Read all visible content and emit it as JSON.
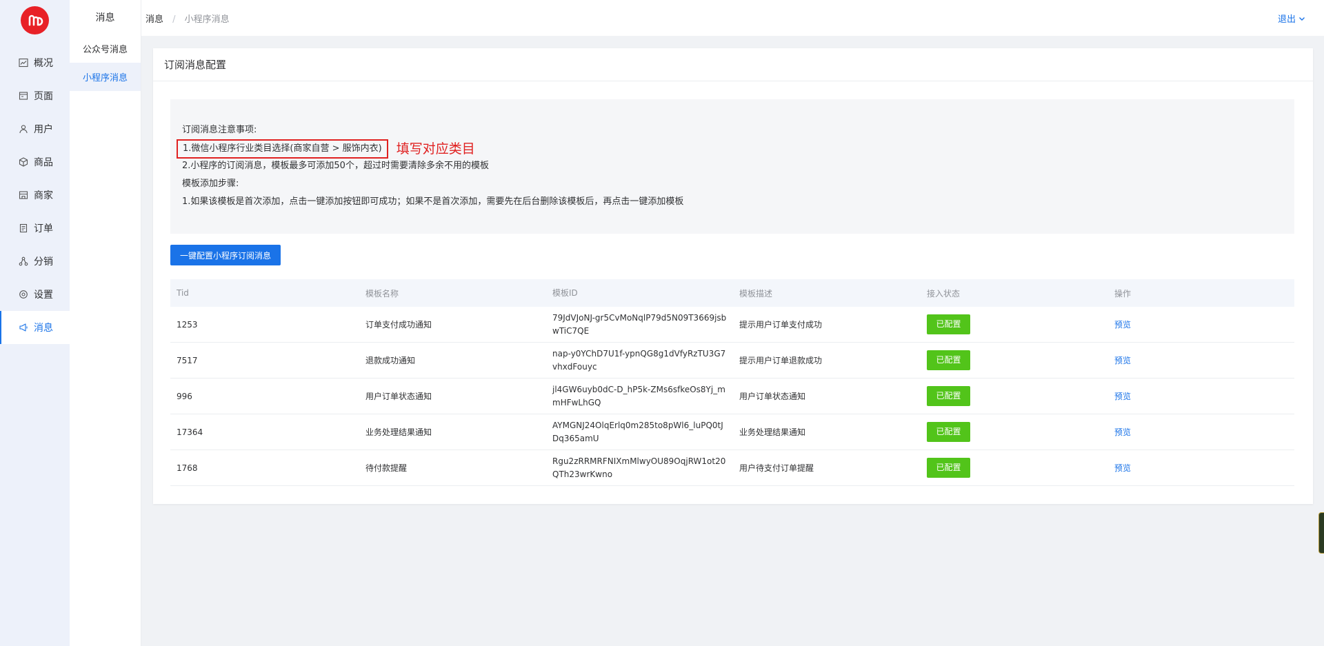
{
  "nav": {
    "items": [
      {
        "label": "概况",
        "icon": "chart-icon",
        "active": false
      },
      {
        "label": "页面",
        "icon": "page-icon",
        "active": false
      },
      {
        "label": "用户",
        "icon": "user-icon",
        "active": false
      },
      {
        "label": "商品",
        "icon": "box-icon",
        "active": false
      },
      {
        "label": "商家",
        "icon": "store-icon",
        "active": false
      },
      {
        "label": "订单",
        "icon": "order-icon",
        "active": false
      },
      {
        "label": "分销",
        "icon": "network-icon",
        "active": false
      },
      {
        "label": "设置",
        "icon": "gear-icon",
        "active": false
      },
      {
        "label": "消息",
        "icon": "megaphone-icon",
        "active": true
      }
    ]
  },
  "subnav": {
    "title": "消息",
    "items": [
      {
        "label": "公众号消息",
        "active": false
      },
      {
        "label": "小程序消息",
        "active": true
      }
    ]
  },
  "breadcrumb": {
    "root": "消息",
    "sep": "/",
    "current": "小程序消息"
  },
  "header": {
    "logout": "退出"
  },
  "card": {
    "title": "订阅消息配置",
    "notice": {
      "line0": "订阅消息注意事项:",
      "line1": "1.微信小程序行业类目选择(商家自营 > 服饰内衣)",
      "annotation": "填写对应类目",
      "line2": "2.小程序的订阅消息，模板最多可添加50个，超过时需要清除多余不用的模板",
      "line3": "模板添加步骤:",
      "line4": "1.如果该模板是首次添加，点击一键添加按钮即可成功；如果不是首次添加，需要先在后台删除该模板后，再点击一键添加模板"
    },
    "action_button": "一键配置小程序订阅消息"
  },
  "table": {
    "columns": [
      "Tid",
      "模板名称",
      "模板ID",
      "模板描述",
      "接入状态",
      "操作"
    ],
    "rows": [
      {
        "tid": "1253",
        "name": "订单支付成功通知",
        "template_id": "79JdVJoNJ-gr5CvMoNqlP79d5N09T3669jsbwTiC7QE",
        "desc": "提示用户订单支付成功",
        "status": "已配置",
        "action": "预览"
      },
      {
        "tid": "7517",
        "name": "退款成功通知",
        "template_id": "nap-y0YChD7U1f-ypnQG8g1dVfyRzTU3G7vhxdFouyc",
        "desc": "提示用户订单退款成功",
        "status": "已配置",
        "action": "预览"
      },
      {
        "tid": "996",
        "name": "用户订单状态通知",
        "template_id": "jl4GW6uyb0dC-D_hP5k-ZMs6sfkeOs8Yj_mmHFwLhGQ",
        "desc": "用户订单状态通知",
        "status": "已配置",
        "action": "预览"
      },
      {
        "tid": "17364",
        "name": "业务处理结果通知",
        "template_id": "AYMGNJ24OlqErlq0m285to8pWl6_luPQ0tJDq365amU",
        "desc": "业务处理结果通知",
        "status": "已配置",
        "action": "预览"
      },
      {
        "tid": "1768",
        "name": "待付款提醒",
        "template_id": "Rgu2zRRMRFNIXmMlwyOU89OqjRW1ot20QTh23wrKwno",
        "desc": "用户待支付订单提醒",
        "status": "已配置",
        "action": "预览"
      }
    ]
  },
  "colors": {
    "accent": "#1a73e8",
    "success": "#52c41a",
    "annotation": "#e02020",
    "logo": "#e82127"
  }
}
